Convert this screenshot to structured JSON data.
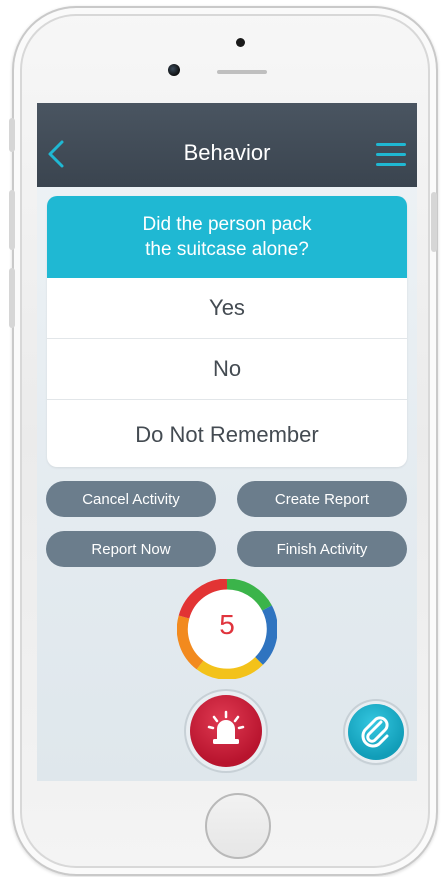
{
  "header": {
    "back_icon": "chevron-left-icon",
    "title": "Behavior",
    "menu_icon": "hamburger-menu-icon",
    "accent_color": "#1fb8d3",
    "bar_color": "#3f4955"
  },
  "question": {
    "line1": "Did the person pack",
    "line2": "the suitcase alone?",
    "background_color": "#1fb8d3"
  },
  "answers": [
    {
      "label": "Yes"
    },
    {
      "label": "No"
    },
    {
      "label": "Do Not Remember"
    }
  ],
  "actions": {
    "cancel_activity": "Cancel Activity",
    "create_report": "Create Report",
    "report_now": "Report Now",
    "finish_activity": "Finish Activity",
    "button_color": "#6b7d8c"
  },
  "timer": {
    "value": "5",
    "ring_colors": [
      "#3bb44a",
      "#2f74c0",
      "#f3c21a",
      "#f28a1e",
      "#e23434"
    ]
  },
  "bottom": {
    "alarm_icon": "siren-icon",
    "alarm_color": "#c8203d",
    "attach_icon": "paperclip-icon",
    "attach_color": "#1fb1cc"
  }
}
